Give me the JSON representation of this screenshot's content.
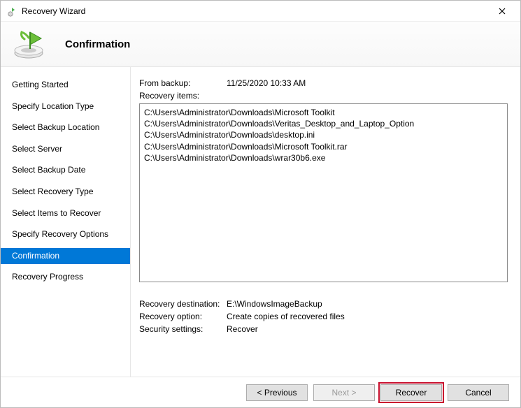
{
  "window": {
    "title": "Recovery Wizard"
  },
  "header": {
    "title": "Confirmation"
  },
  "sidebar": {
    "items": [
      {
        "label": "Getting Started",
        "selected": false
      },
      {
        "label": "Specify Location Type",
        "selected": false
      },
      {
        "label": "Select Backup Location",
        "selected": false
      },
      {
        "label": "Select Server",
        "selected": false
      },
      {
        "label": "Select Backup Date",
        "selected": false
      },
      {
        "label": "Select Recovery Type",
        "selected": false
      },
      {
        "label": "Select Items to Recover",
        "selected": false
      },
      {
        "label": "Specify Recovery Options",
        "selected": false
      },
      {
        "label": "Confirmation",
        "selected": true
      },
      {
        "label": "Recovery Progress",
        "selected": false
      }
    ]
  },
  "content": {
    "from_backup_label": "From backup:",
    "from_backup_value": "11/25/2020 10:33 AM",
    "recovery_items_label": "Recovery items:",
    "recovery_items": [
      "C:\\Users\\Administrator\\Downloads\\Microsoft Toolkit",
      "C:\\Users\\Administrator\\Downloads\\Veritas_Desktop_and_Laptop_Option",
      "C:\\Users\\Administrator\\Downloads\\desktop.ini",
      "C:\\Users\\Administrator\\Downloads\\Microsoft Toolkit.rar",
      "C:\\Users\\Administrator\\Downloads\\wrar30b6.exe"
    ],
    "dest_label": "Recovery destination:",
    "dest_value": "E:\\WindowsImageBackup",
    "option_label": "Recovery option:",
    "option_value": "Create copies of recovered files",
    "security_label": "Security settings:",
    "security_value": "Recover"
  },
  "footer": {
    "previous": "< Previous",
    "next": "Next >",
    "recover": "Recover",
    "cancel": "Cancel"
  }
}
